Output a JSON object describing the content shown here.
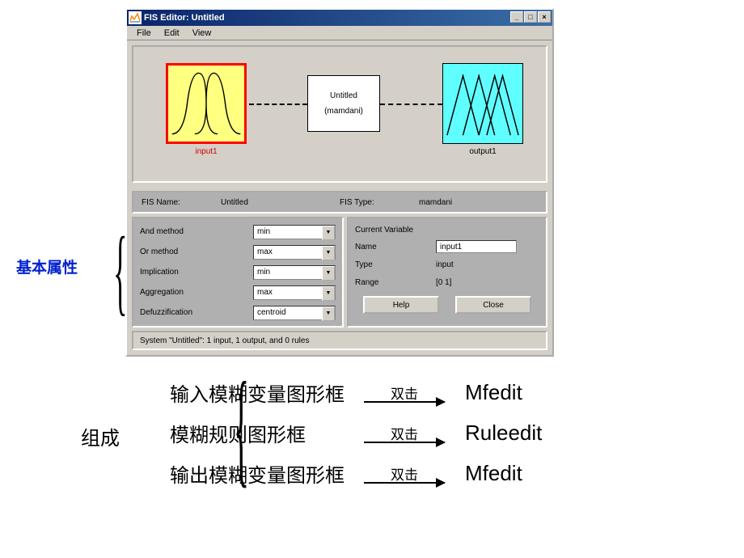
{
  "annotation": {
    "basic_props": "基本属性"
  },
  "window": {
    "title": "FIS Editor: Untitled",
    "menu": {
      "file": "File",
      "edit": "Edit",
      "view": "View"
    },
    "diagram": {
      "input_label": "input1",
      "center_name": "Untitled",
      "center_type": "(mamdani)",
      "output_label": "output1"
    },
    "info": {
      "name_lbl": "FIS Name:",
      "name_val": "Untitled",
      "type_lbl": "FIS Type:",
      "type_val": "mamdani"
    },
    "props": {
      "and": {
        "lbl": "And method",
        "val": "min"
      },
      "or": {
        "lbl": "Or method",
        "val": "max"
      },
      "imp": {
        "lbl": "Implication",
        "val": "min"
      },
      "agg": {
        "lbl": "Aggregation",
        "val": "max"
      },
      "defuzz": {
        "lbl": "Defuzzification",
        "val": "centroid"
      }
    },
    "cv": {
      "title": "Current Variable",
      "name_lbl": "Name",
      "name_val": "input1",
      "type_lbl": "Type",
      "type_val": "input",
      "range_lbl": "Range",
      "range_val": "[0 1]"
    },
    "buttons": {
      "help": "Help",
      "close": "Close"
    },
    "status": "System \"Untitled\": 1 input, 1 output, and 0 rules"
  },
  "bottom": {
    "group_label": "组成",
    "dblclick": "双击",
    "rows": [
      {
        "desc": "输入模糊变量图形框",
        "target": "Mfedit"
      },
      {
        "desc": "模糊规则图形框",
        "target": "Ruleedit"
      },
      {
        "desc": "输出模糊变量图形框",
        "target": "Mfedit"
      }
    ]
  }
}
